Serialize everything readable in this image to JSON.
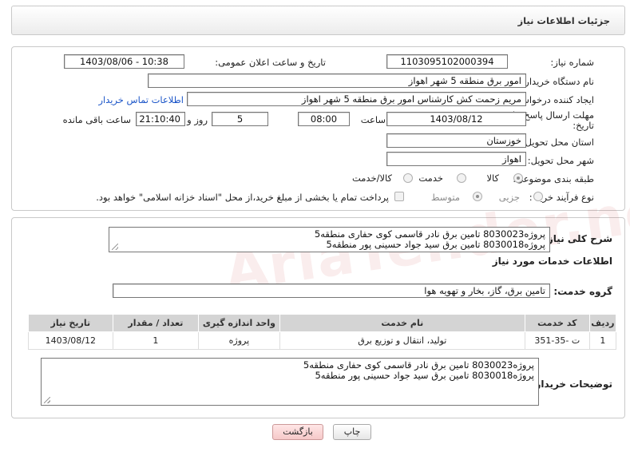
{
  "header": {
    "title": "جزئیات اطلاعات نیاز"
  },
  "fields": {
    "need_number_label": "شماره نیاز:",
    "need_number": "1103095102000394",
    "announce_label": "تاریخ و ساعت اعلان عمومی:",
    "announce_value": "1403/08/06 - 10:38",
    "buyer_org_label": "نام دستگاه خریدار:",
    "buyer_org": "امور برق منطقه 5 شهر اهواز",
    "requester_label": "ایجاد کننده درخواست:",
    "requester": "مریم زحمت کش کارشناس امور برق منطقه 5 شهر اهواز",
    "contact_link": "اطلاعات تماس خریدار",
    "deadline_label_1": "مهلت ارسال پاسخ: تا",
    "deadline_label_2": "تاریخ:",
    "deadline_date": "1403/08/12",
    "time_label": "ساعت",
    "deadline_time": "08:00",
    "days_value": "5",
    "days_label": "روز و",
    "remaining_time": "21:10:40",
    "remaining_label": "ساعت باقی مانده",
    "province_label": "استان محل تحویل:",
    "province": "خوزستان",
    "city_label": "شهر محل تحویل:",
    "city": "اهواز",
    "category_label": "طبقه بندی موضوعی:",
    "category_options": [
      "کالا",
      "خدمت",
      "کالا/خدمت"
    ],
    "process_label": "نوع فرآیند خرید :",
    "process_options": [
      "جزیی",
      "متوسط"
    ],
    "treasury_note": "پرداخت تمام یا بخشی از مبلغ خرید،از محل \"اسناد خزانه اسلامی\" خواهد بود."
  },
  "summary": {
    "label": "شرح کلی نیاز:",
    "line1": "پروژه8030023 تامین برق نادر قاسمی کوی حفاری منطقه5",
    "line2": "پروژه8030018 تامین برق سید جواد حسینی پور منطقه5"
  },
  "services": {
    "section_title": "اطلاعات خدمات مورد نیاز",
    "group_label": "گروه خدمت:",
    "group_value": "تامین برق، گاز، بخار و تهویه هوا",
    "columns": [
      "ردیف",
      "کد خدمت",
      "نام خدمت",
      "واحد اندازه گیری",
      "تعداد / مقدار",
      "تاریخ نیاز"
    ],
    "rows": [
      {
        "row": "1",
        "code": "ت -35-351",
        "name": "تولید، انتقال و توزیع برق",
        "unit": "پروژه",
        "qty": "1",
        "date": "1403/08/12"
      }
    ]
  },
  "buyer_notes": {
    "label": "توضیحات خریدار:",
    "line1": "پروژه8030023 تامین برق نادر قاسمی کوی حفاری منطقه5",
    "line2": "پروژه8030018 تامین برق سید جواد حسینی پور منطقه5"
  },
  "buttons": {
    "print": "چاپ",
    "back": "بازگشت"
  },
  "watermark": {
    "text": "AriaTender.neT"
  }
}
